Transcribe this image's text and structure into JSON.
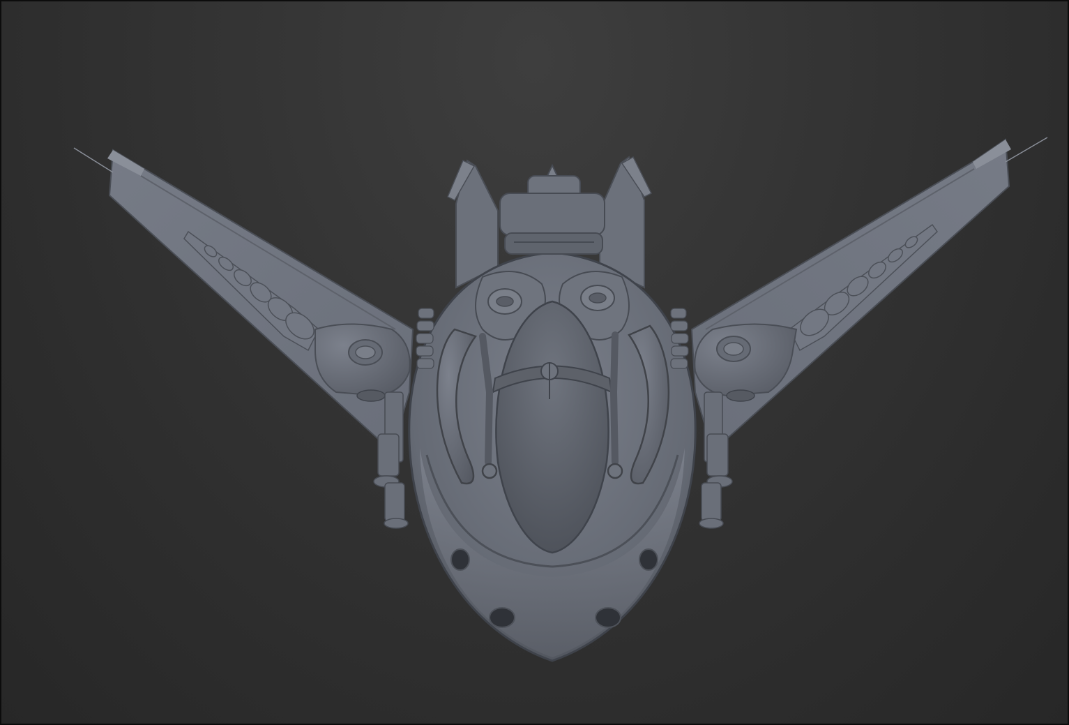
{
  "viewport": {
    "background_color": "#333333",
    "border_color": "#0c0c0c"
  },
  "model": {
    "name": "spaceship-sculpt",
    "material_color": "#6e737e",
    "shadow_color": "#3f434b",
    "highlight_color": "#9aa0ab"
  }
}
